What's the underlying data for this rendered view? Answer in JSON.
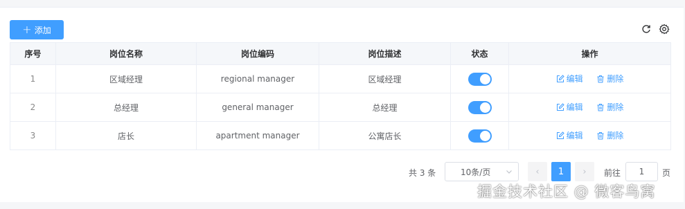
{
  "toolbar": {
    "add_label": "添加",
    "refresh_icon": "refresh-icon",
    "settings_icon": "gear-icon"
  },
  "table": {
    "headers": [
      "序号",
      "岗位名称",
      "岗位编码",
      "岗位描述",
      "状态",
      "操作"
    ],
    "rows": [
      {
        "seq": "1",
        "name": "区域经理",
        "code": "regional manager",
        "desc": "区域经理",
        "enabled": true
      },
      {
        "seq": "2",
        "name": "总经理",
        "code": "general manager",
        "desc": "总经理",
        "enabled": true
      },
      {
        "seq": "3",
        "name": "店长",
        "code": "apartment manager",
        "desc": "公寓店长",
        "enabled": true
      }
    ],
    "edit_label": "编辑",
    "delete_label": "删除"
  },
  "pagination": {
    "total_text": "共 3 条",
    "page_size": "10条/页",
    "prev": "‹",
    "current_page": "1",
    "next": "›",
    "goto_label": "前往",
    "goto_value": "1",
    "goto_suffix": "页"
  },
  "watermark": "掘金技术社区 @ 微客鸟窝",
  "colors": {
    "primary": "#409eff",
    "header_bg": "#f5f7fa",
    "border": "#ebeef5"
  }
}
